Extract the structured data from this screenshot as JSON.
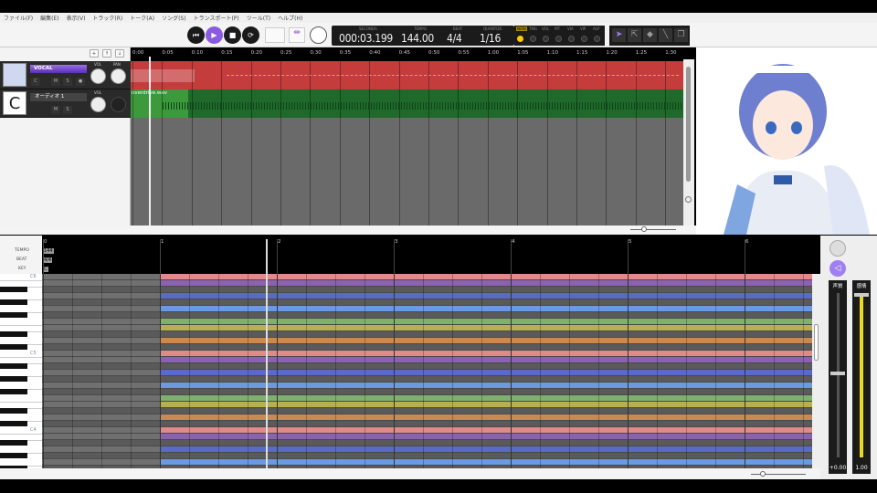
{
  "menu": [
    "ファイル(F)",
    "編集(E)",
    "表示(V)",
    "トラック(R)",
    "トーク(A)",
    "ソング(S)",
    "トランスポート(P)",
    "ツール(T)",
    "ヘルプ(H)"
  ],
  "transport": {
    "seconds_label": "SECONDS",
    "seconds": "000:03.199",
    "tempo_label": "TEMPO",
    "tempo": "144.00",
    "beat_label": "BEAT",
    "beat": "4/4",
    "quantize_label": "QUANTIZE",
    "quantize": "1/16"
  },
  "modules": [
    "NOW",
    "TMG",
    "VOL",
    "PIT",
    "VIA",
    "VIP",
    "ALP"
  ],
  "tracks": [
    {
      "name": "VOCAL",
      "vol_label": "VOL",
      "pan_label": "PAN",
      "buttons": [
        "C",
        "M",
        "S"
      ]
    },
    {
      "name": "オーディオ 1",
      "vol_label": "VOL",
      "buttons": [
        "M",
        "S"
      ],
      "clip": "overdrive.wav"
    }
  ],
  "ruler": [
    "0:00",
    "0:05",
    "0:10",
    "0:15",
    "0:20",
    "0:25",
    "0:30",
    "0:35",
    "0:40",
    "0:45",
    "0:50",
    "0:55",
    "1:00",
    "1:05",
    "1:10",
    "1:15",
    "1:20",
    "1:25",
    "1:30"
  ],
  "pianoroll": {
    "bars": [
      "0",
      "1",
      "2",
      "3",
      "4",
      "5",
      "6"
    ],
    "rows": [
      "TEMPO",
      "BEAT",
      "KEY"
    ],
    "tempo": "144",
    "beat": "4/4",
    "key": "C",
    "notes": [
      "C6",
      "C5",
      "C4"
    ]
  },
  "params": {
    "voice_label": "声質",
    "voice_value": "+0.00",
    "emotion_label": "感情",
    "emotion_value": "1.00",
    "emotion_level": 1.0
  },
  "colors": {
    "vocal": "#c43c3c",
    "audio": "#3c9a3c",
    "accent": "#8a5ae0"
  }
}
